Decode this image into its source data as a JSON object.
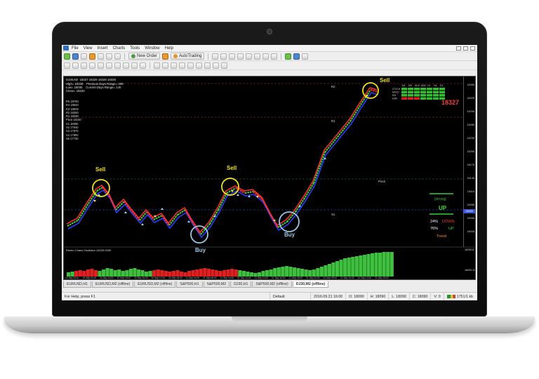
{
  "menu": [
    "File",
    "View",
    "Insert",
    "Charts",
    "Tools",
    "Window",
    "Help"
  ],
  "toolbar": {
    "new_order": "New Order",
    "auto_trading": "AutoTrading"
  },
  "chart": {
    "header": "DJ30,M2  18327 18329 18328 18330",
    "stats": [
      "High= 18235    Previous Days Range= 208",
      "Low= 18035    Current Days Range= 140",
      "Close= 18220"
    ],
    "levels": [
      "R5 18760",
      "R4 18640",
      "R3 18500",
      "R2 18360",
      "R1 18290",
      "Pivot 18150",
      "S1 18080",
      "S2 17940",
      "S3 17870",
      "S4 17800",
      "S5 17730"
    ],
    "price_axis": [
      "18356",
      "18326",
      "18296",
      "18266",
      "18236",
      "18206",
      "18176",
      "18146",
      "18116",
      "18086",
      "18056",
      "18026"
    ],
    "current_price": "18327",
    "current_price_tag": "18090",
    "r2_label": "R2",
    "r1_label": "R1",
    "pivot_label": "Pivot",
    "s1_label": "S1",
    "strength_box": "[strong]",
    "trend_up_label": "UP",
    "down_pct": "24%",
    "down_label": "DOWN",
    "up_pct": "76%",
    "up_label": "UP",
    "trend_label": "Trend",
    "timeframes": [
      "M1",
      "M5",
      "M15",
      "M30",
      "H1",
      "H4",
      "D1"
    ],
    "tf_rows": [
      "STOCH",
      "MACD",
      "RSI",
      "EMA"
    ],
    "annotations": [
      {
        "label": "Sell",
        "color": "#f2e21a"
      },
      {
        "label": "Buy",
        "color": "#9bc8e8"
      },
      {
        "label": "Sell",
        "color": "#f2e21a"
      },
      {
        "label": "Buy",
        "color": "#9bc8e8"
      },
      {
        "label": "Sell",
        "color": "#f2e21a"
      }
    ],
    "oscillator_title": "Renko Chaos Oscillator 18226.0000",
    "oscillator_axis": [
      "18159.8",
      "18003.11"
    ],
    "time_labels": [
      "19 Sep 2016",
      "19 Sep 21:00",
      "20 Sep 14:00",
      "20 Sep 15:00",
      "20 Sep 16:00",
      "20 Sep 17:00",
      "20 Sep 18:00",
      "21 Sep 04:00",
      "21 Sep 06:00",
      "21 Sep 10:00",
      "21 Sep 12:00",
      "21 Sep 14:00",
      "21 Sep 16:00",
      "21 Sep 18:00",
      "21 Sep 20:00",
      "22 Sep 09:00",
      "22 Sep 10:00",
      "22 Sep 13:00",
      "22 Sep 15:00"
    ]
  },
  "tabs": [
    "EURUSD,H1",
    "EURUSD,M2 (offline)",
    "EURUSD,M2 (offline)",
    "S&P500,H1",
    "S&P500,M2",
    "DJ30,H1",
    "S&P500,M2 (offline)",
    "DJ30,M2 (offline)"
  ],
  "active_tab": 7,
  "status": {
    "help": "For Help, press F1",
    "profile": "Default",
    "datetime": "2016.09.21 16:00",
    "open": "O: 18090",
    "high": "H: 18090",
    "low": "L: 18090",
    "close": "C: 18090",
    "volume": "V: 0",
    "traffic": "1751/1 kb"
  },
  "colors": {
    "renko_up": "#3fd23f",
    "renko_down": "#ff3030",
    "channel_upper": "#ff2a2a",
    "channel_lower": "#2a3cff",
    "signal_up": "#9bd8ff",
    "signal_down": "#f7e94a",
    "hist_up": "#3ec03e",
    "hist_down": "#e02020"
  }
}
